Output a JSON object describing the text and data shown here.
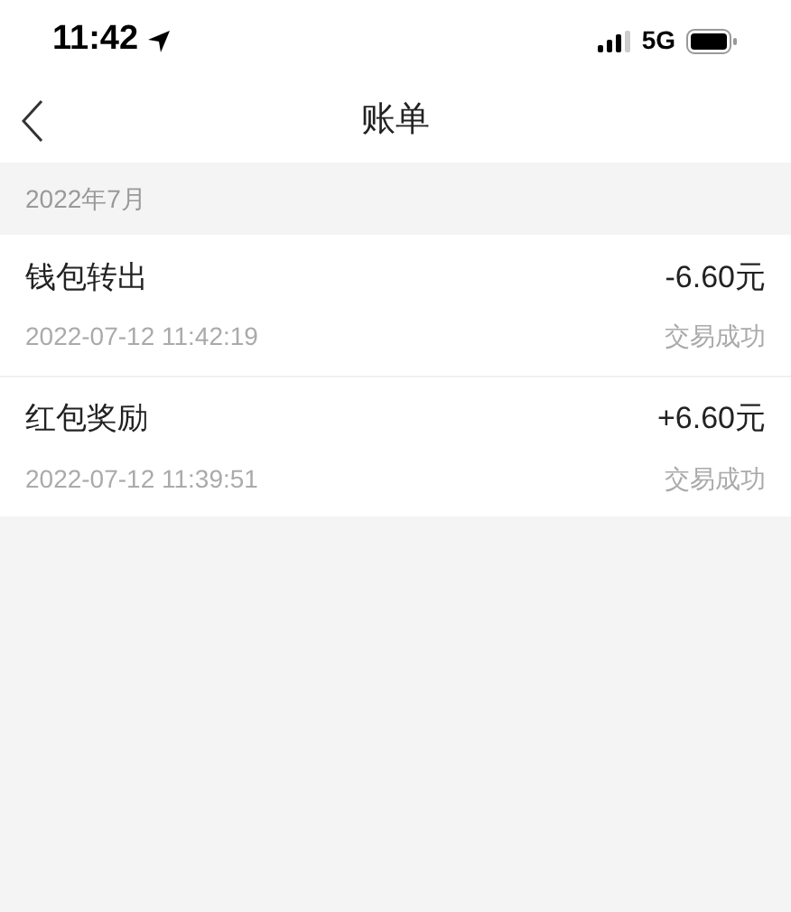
{
  "status_bar": {
    "time": "11:42",
    "network": "5G"
  },
  "nav": {
    "title": "账单"
  },
  "section": {
    "title": "2022年7月"
  },
  "transactions": [
    {
      "name": "钱包转出",
      "amount": "-6.60元",
      "time": "2022-07-12 11:42:19",
      "status": "交易成功"
    },
    {
      "name": "红包奖励",
      "amount": "+6.60元",
      "time": "2022-07-12 11:39:51",
      "status": "交易成功"
    }
  ]
}
